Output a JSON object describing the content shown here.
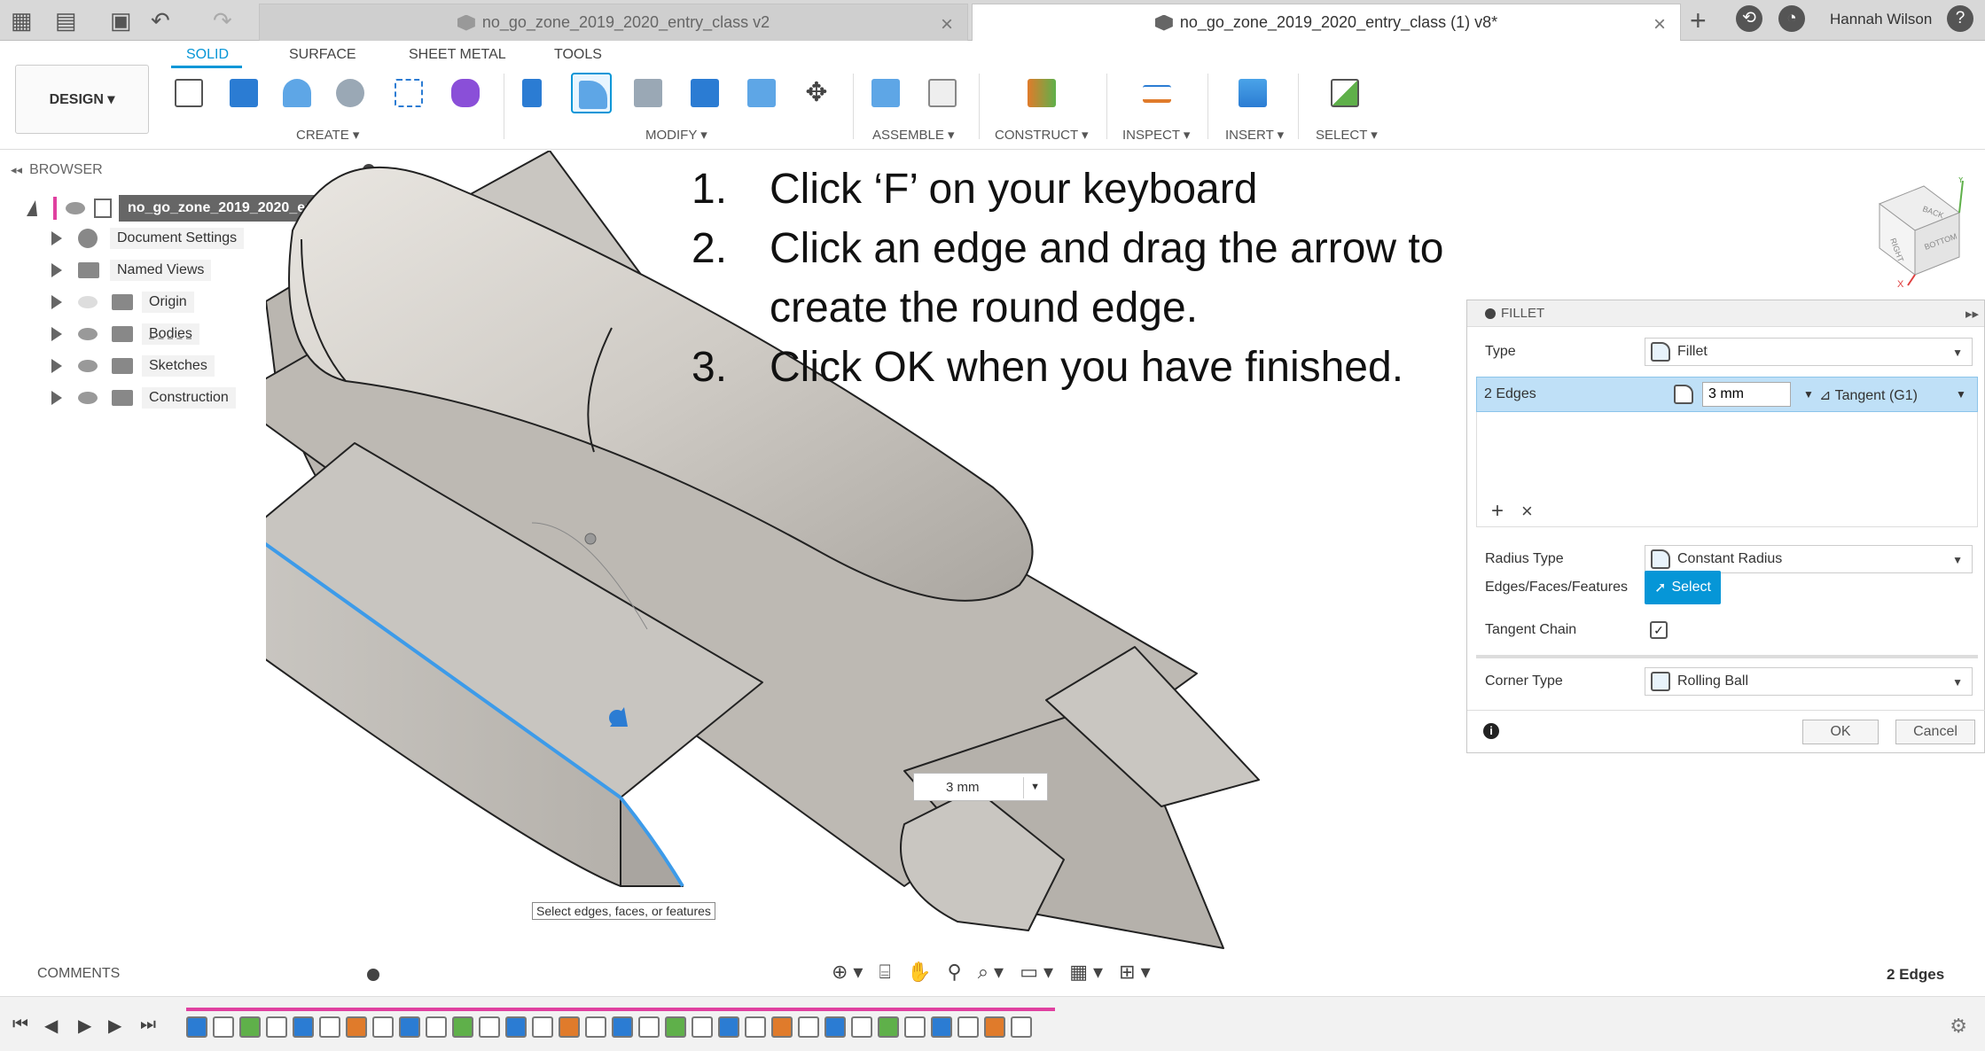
{
  "tabs": {
    "inactive_title": "no_go_zone_2019_2020_entry_class v2",
    "active_title": "no_go_zone_2019_2020_entry_class (1) v8*",
    "close_glyph": "×",
    "new_tab_glyph": "+"
  },
  "user": {
    "name": "Hannah Wilson"
  },
  "toolbar": {
    "design_label": "DESIGN ▾",
    "section_tabs": [
      "SOLID",
      "SURFACE",
      "SHEET METAL",
      "TOOLS"
    ],
    "groups": [
      "CREATE ▾",
      "MODIFY ▾",
      "ASSEMBLE ▾",
      "CONSTRUCT ▾",
      "INSPECT ▾",
      "INSERT ▾",
      "SELECT ▾"
    ]
  },
  "browser": {
    "title": "BROWSER",
    "collapse_glyph": "◂◂",
    "root": "no_go_zone_2019_2020_entr...",
    "nodes": [
      "Document Settings",
      "Named Views",
      "Origin",
      "Bodies",
      "Sketches",
      "Construction"
    ]
  },
  "instructions": [
    {
      "num": "1.",
      "text": "Click ‘F’ on your keyboard"
    },
    {
      "num": "2.",
      "text": "Click an edge and drag the arrow to",
      "cont": "create the round edge."
    },
    {
      "num": "3.",
      "text": "Click OK when you have finished."
    }
  ],
  "fillet": {
    "title": "FILLET",
    "expand_glyph": "▸▸",
    "type_label": "Type",
    "type_value": "Fillet",
    "edges_label": "2 Edges",
    "radius_value": "3 mm",
    "tangent_value": "Tangent (G1)",
    "add_glyph": "+",
    "remove_glyph": "×",
    "radius_type_label": "Radius Type",
    "radius_type_value": "Constant Radius",
    "edges_faces_label": "Edges/Faces/Features",
    "select_label": "Select",
    "tangent_chain_label": "Tangent Chain",
    "tangent_chain_checked": "✓",
    "corner_type_label": "Corner Type",
    "corner_type_value": "Rolling Ball",
    "info_glyph": "i",
    "ok_label": "OK",
    "cancel_label": "Cancel"
  },
  "viewport": {
    "dimension_value": "3 mm",
    "tooltip": "Select edges, faces, or features",
    "viewcube_faces": [
      "BACK",
      "RIGHT",
      "BOTTOM"
    ],
    "axis_x": "X",
    "axis_y": "Y"
  },
  "comments": {
    "label": "COMMENTS"
  },
  "status": {
    "selection": "2 Edges"
  },
  "colors": {
    "accent": "#0696d7",
    "timeline_marker": "#e040a0",
    "selection_row": "#bfe0f7"
  }
}
